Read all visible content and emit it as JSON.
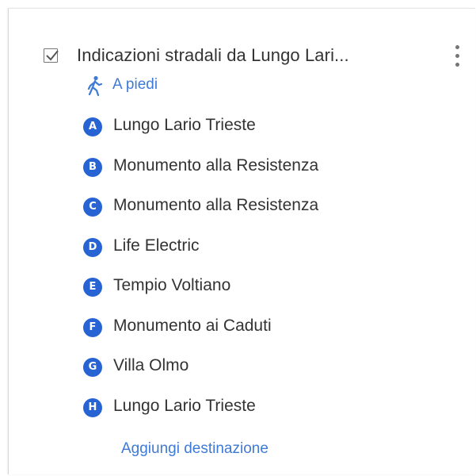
{
  "layer": {
    "checked": true,
    "title": "Indicazioni stradali da Lungo Lari...",
    "menu_icon": "more-vert-icon"
  },
  "travel_mode": {
    "icon": "walking-icon",
    "label": "A piedi"
  },
  "stops": [
    {
      "letter": "A",
      "name": "Lungo Lario Trieste"
    },
    {
      "letter": "B",
      "name": "Monumento alla Resistenza"
    },
    {
      "letter": "C",
      "name": "Monumento alla Resistenza"
    },
    {
      "letter": "D",
      "name": "Life Electric"
    },
    {
      "letter": "E",
      "name": "Tempio Voltiano"
    },
    {
      "letter": "F",
      "name": "Monumento ai Caduti"
    },
    {
      "letter": "G",
      "name": "Villa Olmo"
    },
    {
      "letter": "H",
      "name": "Lungo Lario Trieste"
    }
  ],
  "add_destination_label": "Aggiungi destinazione",
  "colors": {
    "accent": "#3e7ad6",
    "badge": "#2763d3",
    "text": "#333333"
  }
}
